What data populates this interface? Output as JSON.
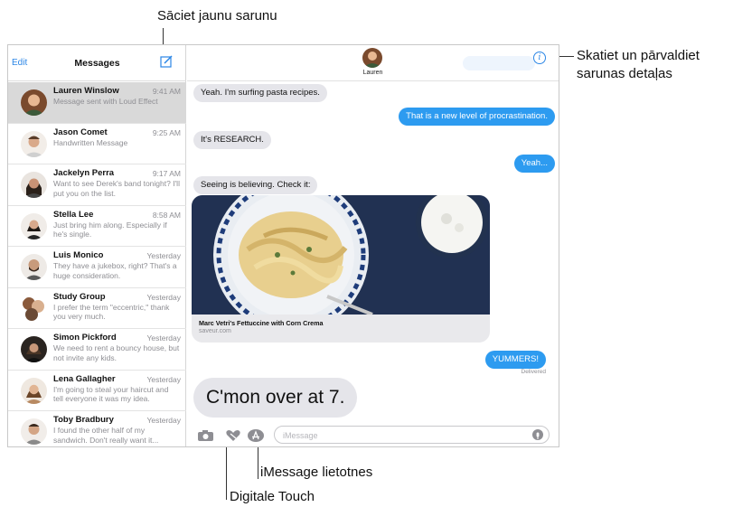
{
  "callouts": {
    "compose": "Sāciet jaunu sarunu",
    "details_line1": "Skatiet un pārvaldiet",
    "details_line2": "sarunas detaļas",
    "imessage_apps": "iMessage lietotnes",
    "digital_touch": "Digitale Touch"
  },
  "sidebar": {
    "edit_label": "Edit",
    "title": "Messages",
    "compose_icon": "compose-icon",
    "conversations": [
      {
        "name": "Lauren Winslow",
        "time": "9:41 AM",
        "preview": "Message sent with Loud Effect",
        "selected": true
      },
      {
        "name": "Jason Comet",
        "time": "9:25 AM",
        "preview": "Handwritten Message"
      },
      {
        "name": "Jackelyn Perra",
        "time": "9:17 AM",
        "preview": "Want to see Derek's band tonight? I'll put you on the list."
      },
      {
        "name": "Stella Lee",
        "time": "8:58 AM",
        "preview": "Just bring him along. Especially if he's single."
      },
      {
        "name": "Luis Monico",
        "time": "Yesterday",
        "preview": "They have a jukebox, right? That's a huge consideration."
      },
      {
        "name": "Study Group",
        "time": "Yesterday",
        "preview": "I prefer the term \"eccentric,\" thank you very much."
      },
      {
        "name": "Simon Pickford",
        "time": "Yesterday",
        "preview": "We need to rent a bouncy house, but not invite any kids."
      },
      {
        "name": "Lena Gallagher",
        "time": "Yesterday",
        "preview": "I'm going to steal your haircut and tell everyone it was my idea."
      },
      {
        "name": "Toby Bradbury",
        "time": "Yesterday",
        "preview": "I found the other half of my sandwich. Don't really want it..."
      }
    ]
  },
  "conversation": {
    "contact_name": "Lauren",
    "info_icon": "info-icon",
    "messages": [
      {
        "from": "in",
        "text": "Yeah. I'm surfing pasta recipes."
      },
      {
        "from": "out",
        "text": "That is a new level of procrastination."
      },
      {
        "from": "in",
        "text": "It's RESEARCH."
      },
      {
        "from": "out",
        "text": "Yeah..."
      },
      {
        "from": "in",
        "text": "Seeing is believing. Check it:"
      },
      {
        "from": "out",
        "text": "YUMMERS!"
      },
      {
        "from": "in",
        "text": "C'mon over at 7.",
        "style": "loud"
      }
    ],
    "link_preview": {
      "title": "Marc Vetri's Fettuccine with Corn Crema",
      "domain": "saveur.com"
    },
    "delivered_label": "Delivered"
  },
  "input_bar": {
    "placeholder": "iMessage",
    "camera_icon": "camera-icon",
    "digital_touch_icon": "digital-touch-heart-icon",
    "apps_icon": "app-store-icon",
    "mic_icon": "microphone-icon"
  },
  "colors": {
    "accent": "#2b86e6",
    "outgoing_bubble": "#2d9bf0",
    "incoming_bubble": "#e5e5ea"
  }
}
